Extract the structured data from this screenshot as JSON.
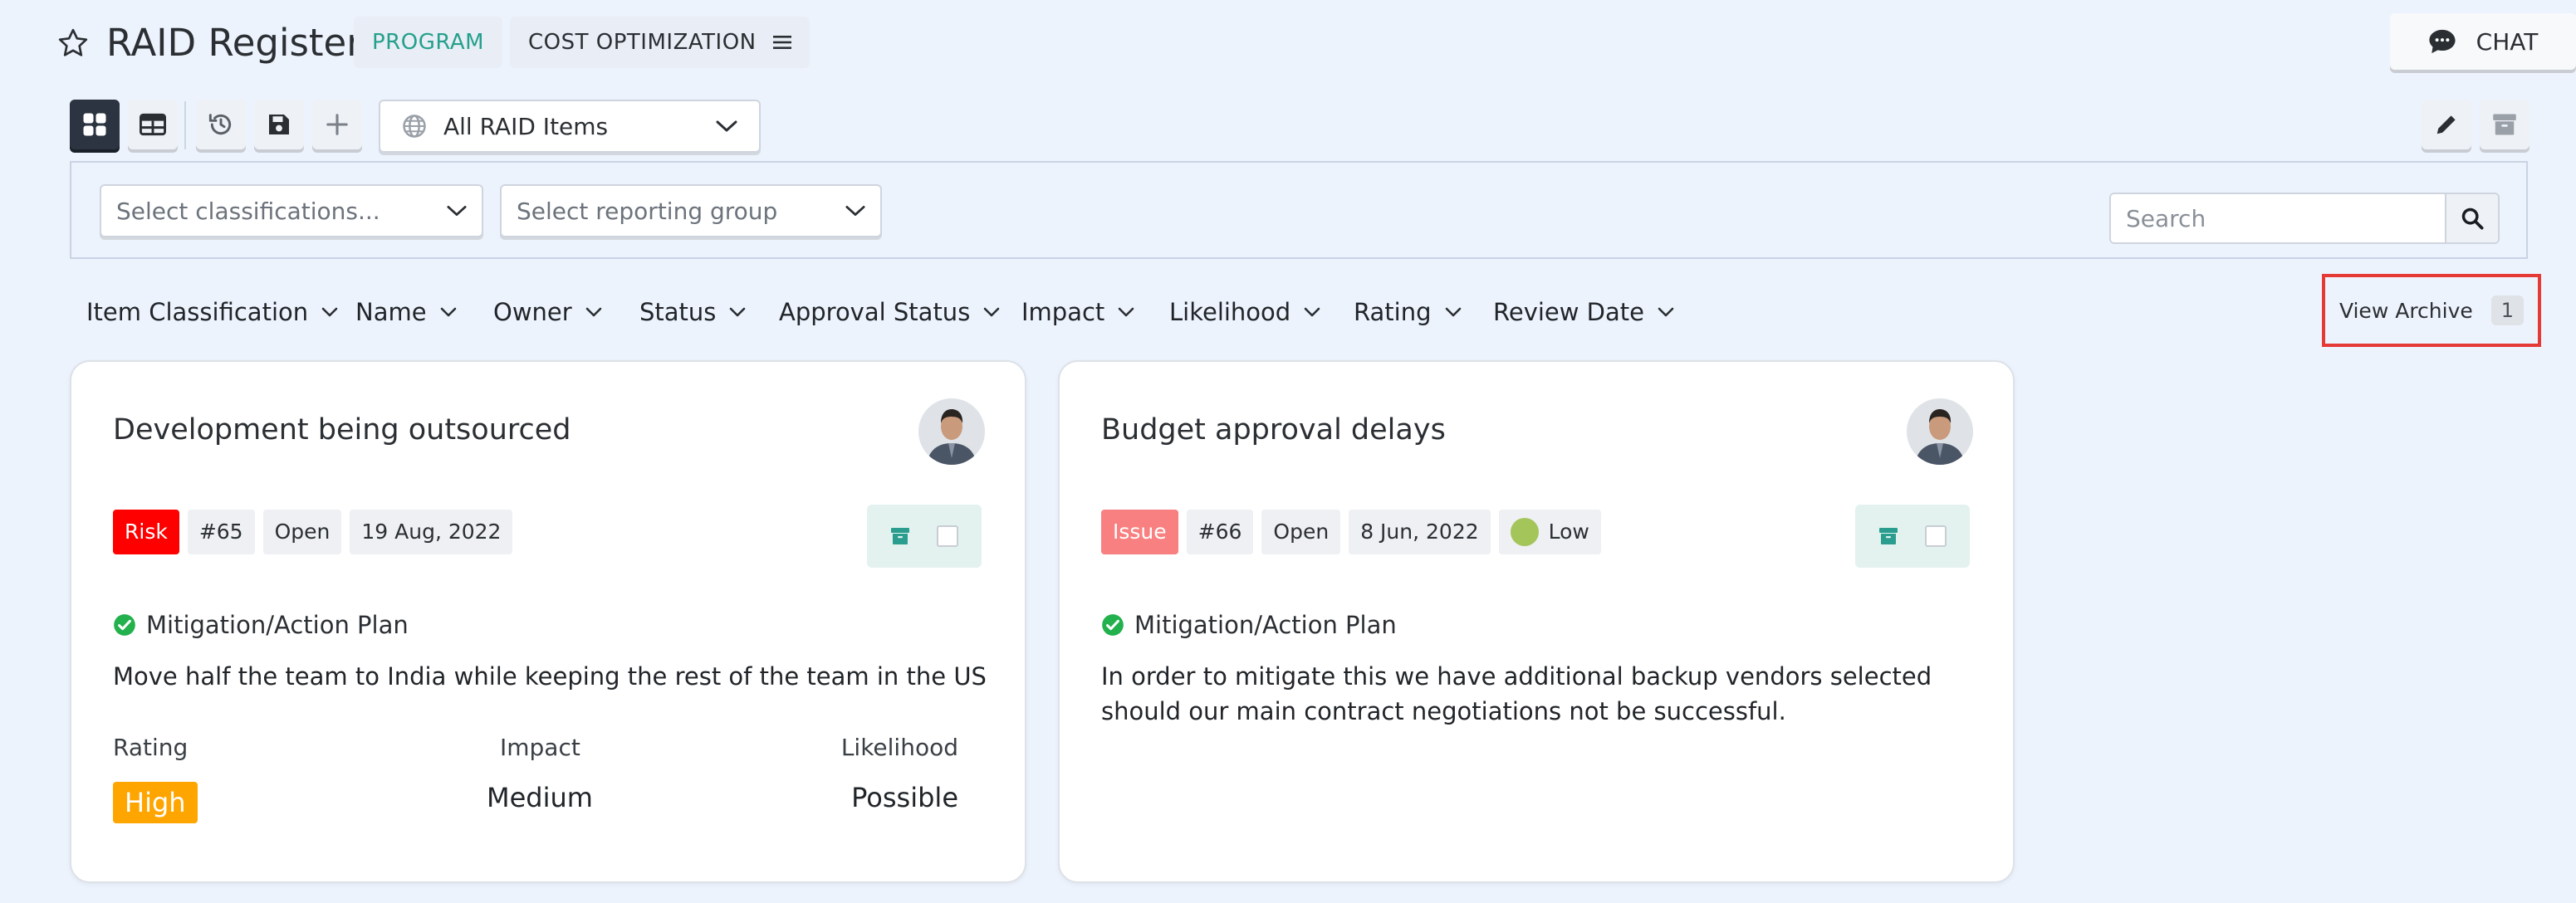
{
  "header": {
    "title": "RAID Register",
    "program_chip": "PROGRAM",
    "cost_chip": "COST OPTIMIZATION",
    "chat_label": "CHAT"
  },
  "toolbar": {
    "view_select": "All RAID Items"
  },
  "filters": {
    "classifications_placeholder": "Select classifications...",
    "reporting_group_placeholder": "Select reporting group",
    "search_placeholder": "Search"
  },
  "sort_bar": {
    "items": [
      "Item Classification",
      "Name",
      "Owner",
      "Status",
      "Approval Status",
      "Impact",
      "Likelihood",
      "Rating",
      "Review Date"
    ],
    "view_archive_label": "View Archive",
    "archive_count": "1"
  },
  "cards": [
    {
      "title": "Development being outsourced",
      "type": "Risk",
      "id": "#65",
      "status": "Open",
      "date": "19 Aug, 2022",
      "plan_label": "Mitigation/Action Plan",
      "plan_text": "Move half the team to India while keeping the rest of the team in the US",
      "rating_label": "Rating",
      "rating_value": "High",
      "impact_label": "Impact",
      "impact_value": "Medium",
      "likelihood_label": "Likelihood",
      "likelihood_value": "Possible"
    },
    {
      "title": "Budget approval delays",
      "type": "Issue",
      "id": "#66",
      "status": "Open",
      "date": "8 Jun, 2022",
      "priority": "Low",
      "plan_label": "Mitigation/Action Plan",
      "plan_text": "In order to mitigate this we have additional backup vendors selected should our main contract negotiations not be successful."
    }
  ],
  "colors": {
    "background": "#edf3fd",
    "accent_teal": "#25a08c",
    "risk_red": "#ff0000",
    "issue_pink": "#f88080",
    "high_orange": "#ffa500",
    "low_green": "#a3c55a",
    "check_green": "#22b14c"
  }
}
